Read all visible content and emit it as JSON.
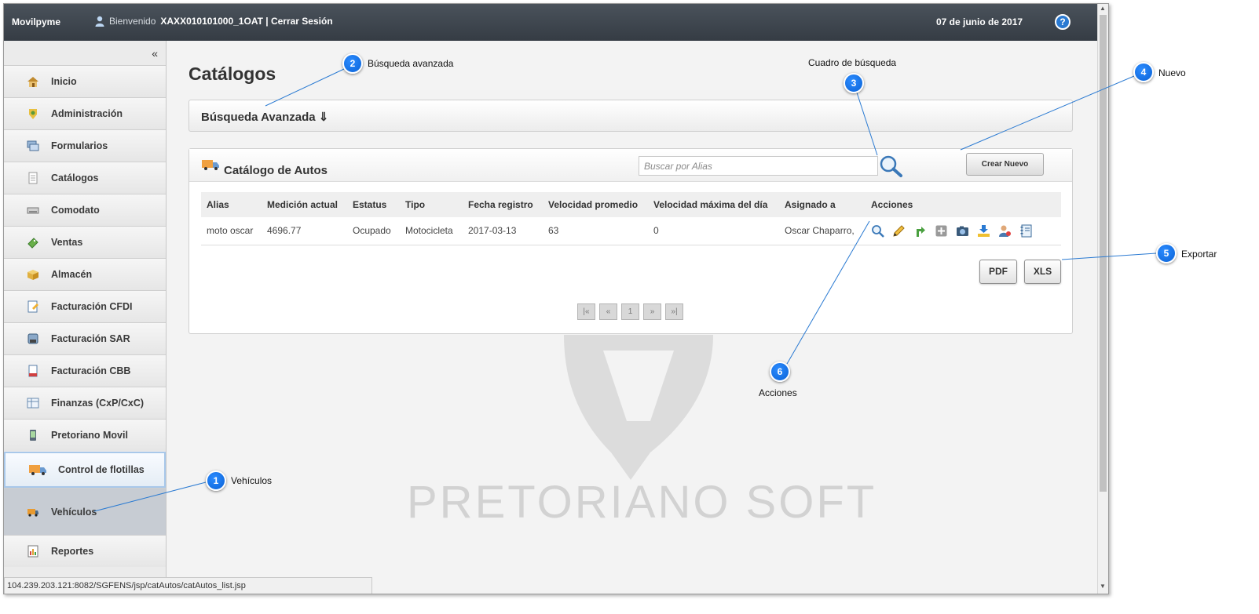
{
  "header": {
    "brand": "Movilpyme",
    "welcome": "Bienvenido",
    "user": "XAXX010101000_1OAT | Cerrar Sesión",
    "date": "07 de junio de 2017",
    "help": "?"
  },
  "sidebar": {
    "collapse": "«",
    "items": [
      {
        "label": "Inicio",
        "icon": "home-icon"
      },
      {
        "label": "Administración",
        "icon": "admin-icon"
      },
      {
        "label": "Formularios",
        "icon": "forms-icon"
      },
      {
        "label": "Catálogos",
        "icon": "catalog-icon"
      },
      {
        "label": "Comodato",
        "icon": "comodato-icon"
      },
      {
        "label": "Ventas",
        "icon": "sales-icon"
      },
      {
        "label": "Almacén",
        "icon": "warehouse-icon"
      },
      {
        "label": "Facturación CFDI",
        "icon": "invoice-cfdi-icon"
      },
      {
        "label": "Facturación SAR",
        "icon": "invoice-sar-icon"
      },
      {
        "label": "Facturación CBB",
        "icon": "invoice-cbb-icon"
      },
      {
        "label": "Finanzas (CxP/CxC)",
        "icon": "finance-icon"
      },
      {
        "label": "Pretoriano Movil",
        "icon": "mobile-icon"
      },
      {
        "label": "Control de flotillas",
        "icon": "fleet-icon"
      },
      {
        "label": "Vehículos",
        "icon": "vehicle-icon"
      },
      {
        "label": "Reportes",
        "icon": "reports-icon"
      }
    ]
  },
  "main": {
    "title": "Catálogos",
    "advanced_search": "Búsqueda Avanzada ⇓",
    "panel_title": "Catálogo de Autos",
    "search_placeholder": "Buscar por Alias",
    "new_button": "Crear Nuevo",
    "columns": [
      "Alias",
      "Medición actual",
      "Estatus",
      "Tipo",
      "Fecha registro",
      "Velocidad promedio",
      "Velocidad máxima del día",
      "Asignado a",
      "Acciones"
    ],
    "rows": [
      [
        "moto oscar",
        "4696.77",
        "Ocupado",
        "Motocicleta",
        "2017-03-13",
        "63",
        "0",
        "Oscar Chaparro,"
      ]
    ],
    "action_icons": [
      "view-icon",
      "edit-icon",
      "route-icon",
      "add-icon",
      "camera-icon",
      "download-icon",
      "assign-user-icon",
      "log-icon"
    ],
    "export": {
      "pdf": "PDF",
      "xls": "XLS"
    },
    "pager": [
      "|«",
      "«",
      "1",
      "»",
      "»|"
    ],
    "watermark": "PRETORIANO SOFT"
  },
  "status_bar": "104.239.203.121:8082/SGFENS/jsp/catAutos/catAutos_list.jsp",
  "callouts": [
    {
      "num": "1",
      "label": "Vehículos"
    },
    {
      "num": "2",
      "label": "Búsqueda avanzada"
    },
    {
      "num": "3",
      "label": "Cuadro de búsqueda"
    },
    {
      "num": "4",
      "label": "Nuevo"
    },
    {
      "num": "5",
      "label": "Exportar"
    },
    {
      "num": "6",
      "label": "Acciones"
    }
  ],
  "colors": {
    "callout": "#0a62d6",
    "topbar": "#3d444c",
    "sidebar": "#ebebeb"
  }
}
